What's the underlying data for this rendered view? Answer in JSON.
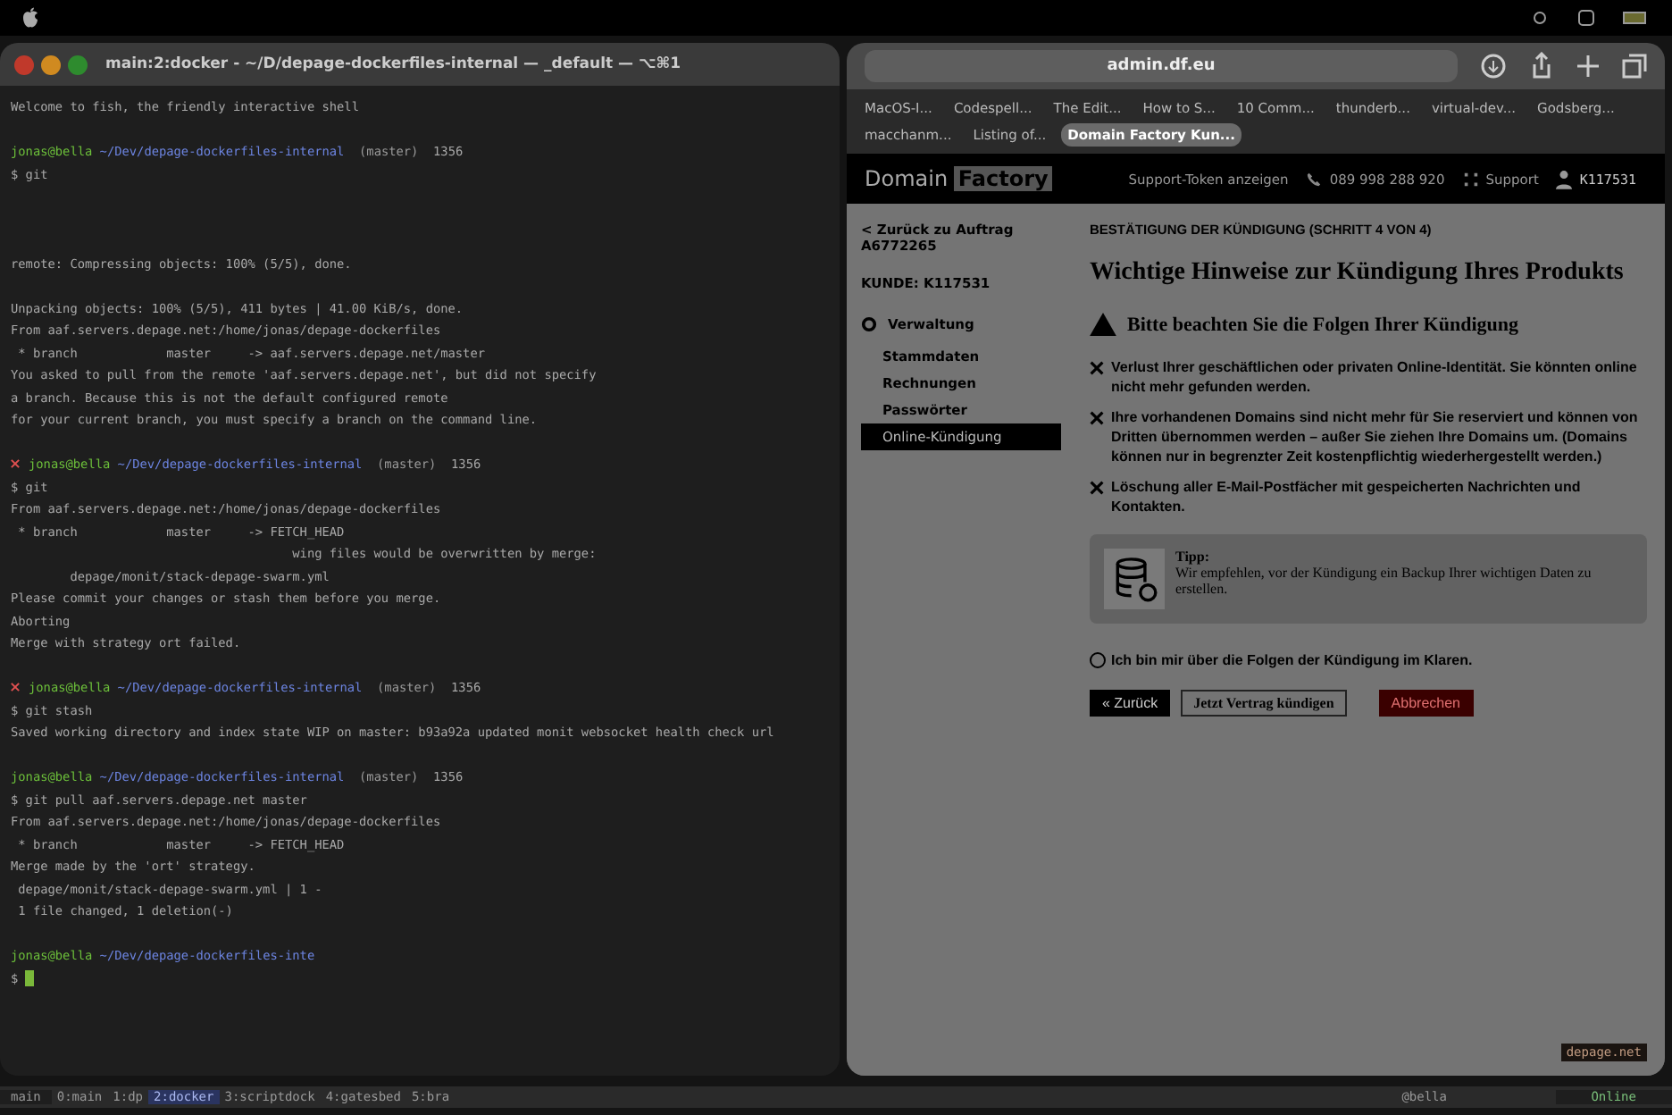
{
  "terminal": {
    "title": "main:2:docker - ~/D/depage-dockerfiles-internal — _default — ⌥⌘1",
    "lines": [
      {
        "kind": "out",
        "text": "Welcome to fish, the friendly interactive shell"
      },
      {
        "kind": "gap"
      },
      {
        "kind": "prompt",
        "user": "jonas@bella",
        "path": "~/Dev/depage-dockerfiles-internal",
        "branch": "(master)",
        "extra": "1356",
        "error": false
      },
      {
        "kind": "cmd",
        "text": "$ git"
      },
      {
        "kind": "gap"
      },
      {
        "kind": "gap"
      },
      {
        "kind": "gap"
      },
      {
        "kind": "out",
        "text": "remote: Compressing objects: 100% (5/5), done."
      },
      {
        "kind": "gap"
      },
      {
        "kind": "out",
        "text": "Unpacking objects: 100% (5/5), 411 bytes | 41.00 KiB/s, done."
      },
      {
        "kind": "out",
        "text": "From aaf.servers.depage.net:/home/jonas/depage-dockerfiles"
      },
      {
        "kind": "out",
        "text": " * branch            master     -> aaf.servers.depage.net/master"
      },
      {
        "kind": "out",
        "text": "You asked to pull from the remote 'aaf.servers.depage.net', but did not specify"
      },
      {
        "kind": "out",
        "text": "a branch. Because this is not the default configured remote"
      },
      {
        "kind": "out",
        "text": "for your current branch, you must specify a branch on the command line."
      },
      {
        "kind": "gap"
      },
      {
        "kind": "prompt",
        "user": "jonas@bella",
        "path": "~/Dev/depage-dockerfiles-internal",
        "branch": "(master)",
        "extra": "1356",
        "error": true
      },
      {
        "kind": "cmd",
        "text": "$ git"
      },
      {
        "kind": "out",
        "text": "From aaf.servers.depage.net:/home/jonas/depage-dockerfiles"
      },
      {
        "kind": "out",
        "text": " * branch            master     -> FETCH_HEAD"
      },
      {
        "kind": "out",
        "text": "                                      wing files would be overwritten by merge:"
      },
      {
        "kind": "out",
        "text": "        depage/monit/stack-depage-swarm.yml"
      },
      {
        "kind": "out",
        "text": "Please commit your changes or stash them before you merge."
      },
      {
        "kind": "out",
        "text": "Aborting"
      },
      {
        "kind": "out",
        "text": "Merge with strategy ort failed."
      },
      {
        "kind": "gap"
      },
      {
        "kind": "prompt",
        "user": "jonas@bella",
        "path": "~/Dev/depage-dockerfiles-internal",
        "branch": "(master)",
        "extra": "1356",
        "error": true
      },
      {
        "kind": "cmd",
        "text": "$ git stash"
      },
      {
        "kind": "out",
        "text": "Saved working directory and index state WIP on master: b93a92a updated monit websocket health check url"
      },
      {
        "kind": "gap"
      },
      {
        "kind": "prompt",
        "user": "jonas@bella",
        "path": "~/Dev/depage-dockerfiles-internal",
        "branch": "(master)",
        "extra": "1356",
        "error": false
      },
      {
        "kind": "cmd",
        "text": "$ git pull aaf.servers.depage.net master"
      },
      {
        "kind": "out",
        "text": "From aaf.servers.depage.net:/home/jonas/depage-dockerfiles"
      },
      {
        "kind": "out",
        "text": " * branch            master     -> FETCH_HEAD"
      },
      {
        "kind": "out",
        "text": "Merge made by the 'ort' strategy."
      },
      {
        "kind": "out",
        "text": " depage/monit/stack-depage-swarm.yml | 1 -"
      },
      {
        "kind": "out",
        "text": " 1 file changed, 1 deletion(-)"
      },
      {
        "kind": "gap"
      },
      {
        "kind": "prompt",
        "user": "jonas@bella",
        "path": "~/Dev/depage-dockerfiles-inte",
        "error": false
      },
      {
        "kind": "cursor",
        "text": "$"
      }
    ],
    "status_bar": {
      "session": "main",
      "windows": [
        {
          "label": "0:main",
          "selected": false
        },
        {
          "label": "1:dp",
          "selected": false
        },
        {
          "label": "2:docker",
          "selected": true
        },
        {
          "label": "3:scriptdock",
          "selected": false
        },
        {
          "label": "4:gatesbed",
          "selected": false
        },
        {
          "label": "5:bra",
          "selected": false
        }
      ],
      "host": "@bella",
      "state": "Online"
    }
  },
  "browser": {
    "url": "admin.df.eu",
    "tabs": [
      {
        "label": "MacOS-I...",
        "selected": false
      },
      {
        "label": "Codespell...",
        "selected": false
      },
      {
        "label": "The Edit...",
        "selected": false
      },
      {
        "label": "How to S...",
        "selected": false
      },
      {
        "label": "10 Comm...",
        "selected": false
      },
      {
        "label": "thunderb...",
        "selected": false
      },
      {
        "label": "virtual-dev...",
        "selected": false
      },
      {
        "label": "Godsberg...",
        "selected": false
      },
      {
        "label": "macchanm...",
        "selected": false
      },
      {
        "label": "Listing of...",
        "selected": false
      },
      {
        "label": "Domain Factory Kun...",
        "selected": true
      }
    ],
    "header": {
      "logo": [
        "Domain",
        "Factory"
      ],
      "support_token": "Support-Token anzeigen",
      "phone": "089 998 288 920",
      "support": "Support",
      "customer": "K117531"
    },
    "sidebar": {
      "back": "< Zurück zu Auftrag A6772265",
      "customer": "KUNDE: K117531",
      "section": "Verwaltung",
      "items": [
        {
          "label": "Stammdaten",
          "selected": false
        },
        {
          "label": "Rechnungen",
          "selected": false
        },
        {
          "label": "Passwörter",
          "selected": false
        },
        {
          "label": "Online-Kündigung",
          "selected": true
        }
      ]
    },
    "step": "BESTÄTIGUNG DER KÜNDIGUNG (SCHRITT 4 VON 4)",
    "heading": "Wichtige Hinweise zur Kündigung Ihres Produkts",
    "warning": "Bitte beachten Sie die Folgen Ihrer Kündigung",
    "consequences": [
      "Verlust Ihrer geschäftlichen oder privaten Online-Identität. Sie könnten online nicht mehr gefunden werden.",
      "Ihre vorhandenen Domains sind nicht mehr für Sie reserviert und können von Dritten übernommen werden – außer Sie ziehen Ihre Domains um. (Domains können nur in begrenzter Zeit kostenpflichtig wiederhergestellt werden.)",
      "Löschung aller E-Mail-Postfächer mit gespeicherten Nachrichten und Kontakten."
    ],
    "tip": {
      "title": "Tipp:",
      "text": "Wir empfehlen, vor der Kündigung ein Backup Ihrer wichtigen Daten zu erstellen."
    },
    "confirm": {
      "label": "Ich bin mir über die Folgen der Kündigung im Klaren.",
      "checked": false
    },
    "buttons": [
      {
        "kind": "back",
        "label": "« Zurück"
      },
      {
        "kind": "submit",
        "label": "Jetzt Vertrag kündigen"
      },
      {
        "kind": "cancel",
        "label": "Abbrechen"
      }
    ],
    "side_label": "depage.net"
  }
}
